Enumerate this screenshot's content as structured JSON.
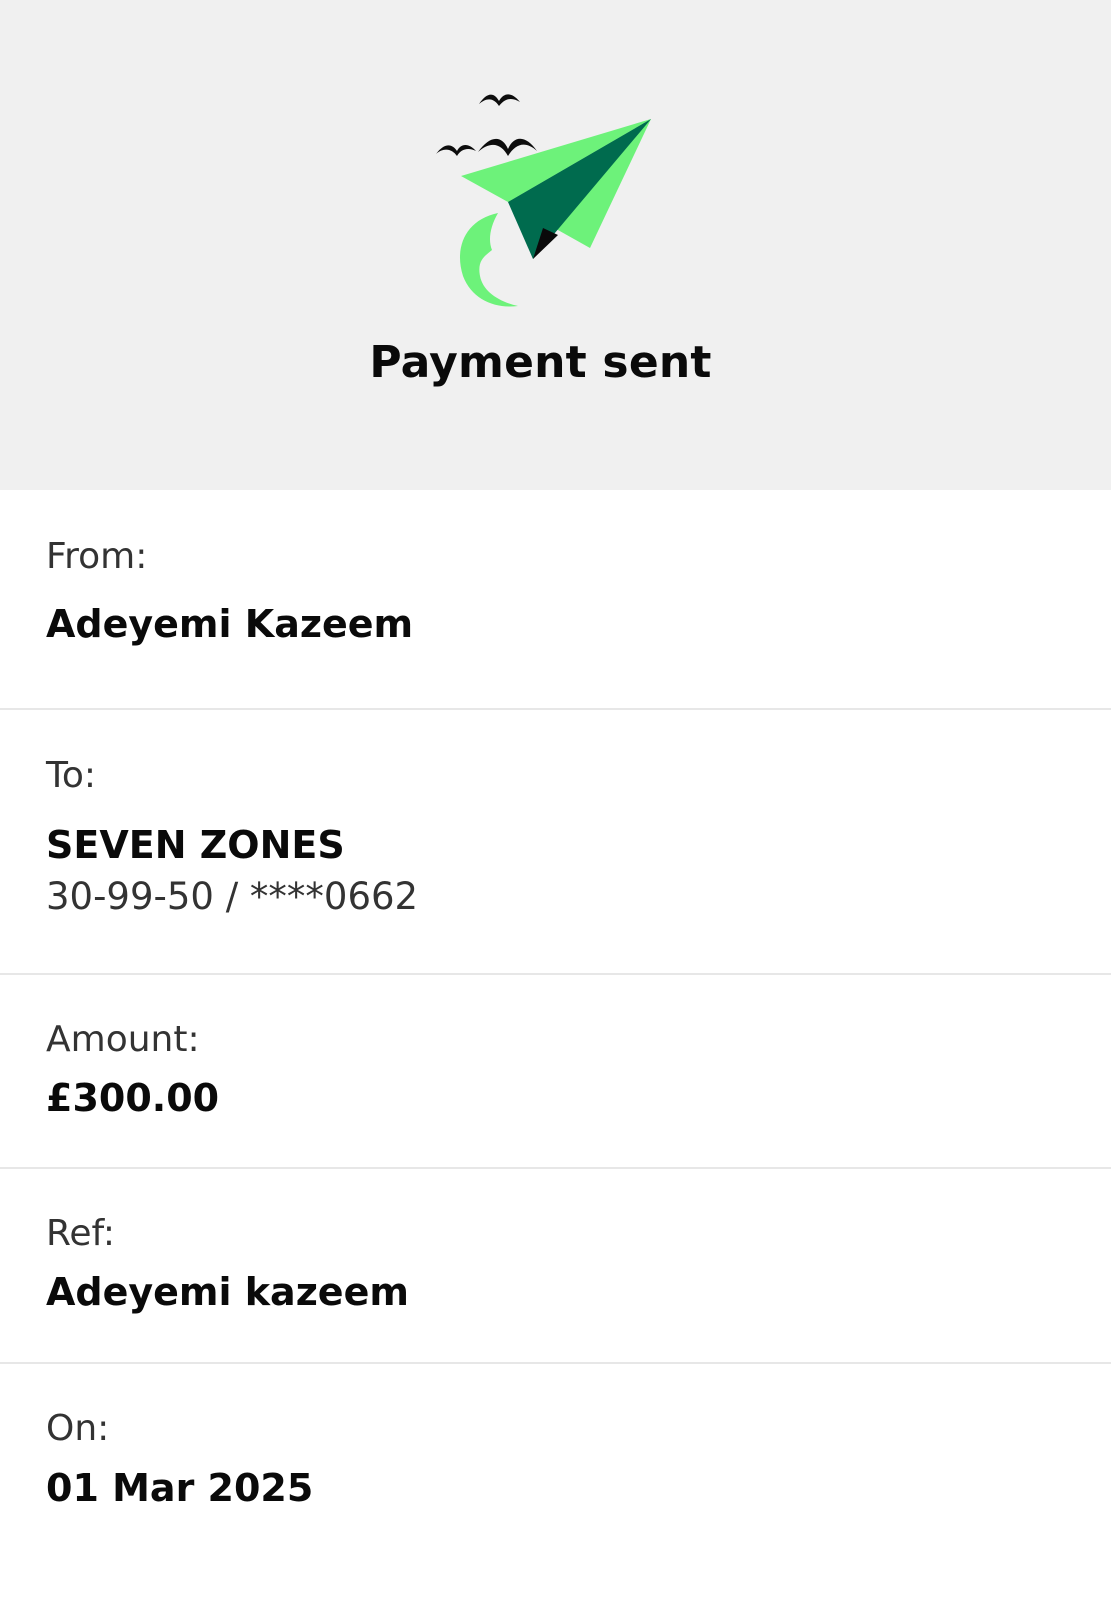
{
  "hero": {
    "title": "Payment sent",
    "icon": "paper-plane-with-birds"
  },
  "details": {
    "from": {
      "label": "From:",
      "value": "Adeyemi Kazeem"
    },
    "to": {
      "label": "To:",
      "name": "SEVEN ZONES",
      "account": "30-99-50 / ****0662"
    },
    "amount": {
      "label": "Amount:",
      "value": "£300.00"
    },
    "ref": {
      "label": "Ref:",
      "value": "Adeyemi kazeem"
    },
    "on": {
      "label": "On:",
      "value": "01 Mar 2025"
    }
  },
  "colors": {
    "hero_background": "#f0f0f0",
    "plane_light": "#6df27a",
    "plane_dark": "#006b4e",
    "text_primary": "#0a0a0a",
    "text_secondary": "#333333",
    "divider": "#e7e7e7"
  }
}
